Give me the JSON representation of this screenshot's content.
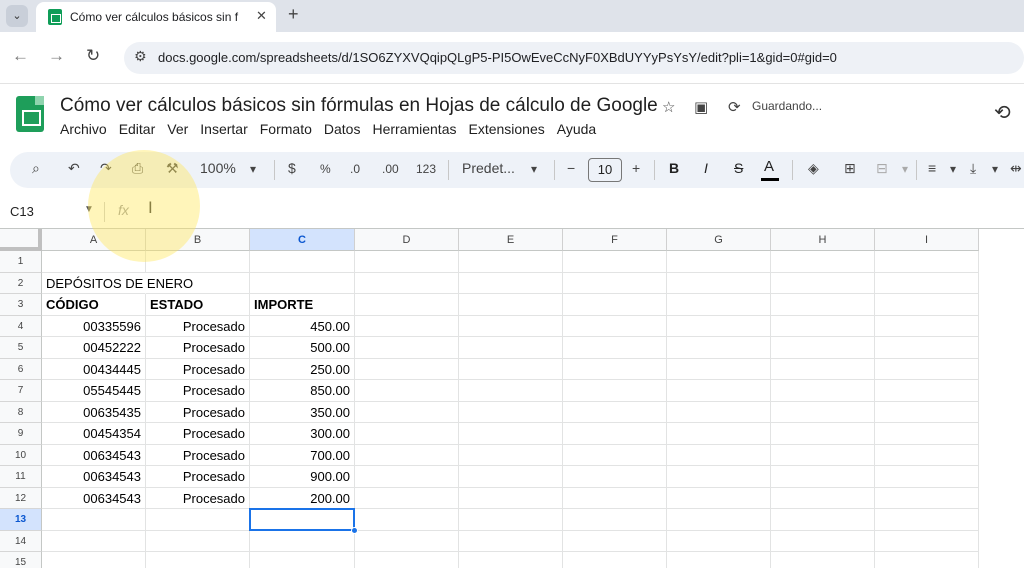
{
  "browser": {
    "tab_title": "Cómo ver cálculos básicos sin f",
    "url": "docs.google.com/spreadsheets/d/1SO6ZYXVQqipQLgP5-PI5OwEveCcNyF0XBdUYYyPsYsY/edit?pli=1&gid=0#gid=0"
  },
  "doc": {
    "title": "Cómo ver cálculos básicos sin fórmulas en Hojas de cálculo de Google",
    "status": "Guardando..."
  },
  "menu": [
    "Archivo",
    "Editar",
    "Ver",
    "Insertar",
    "Formato",
    "Datos",
    "Herramientas",
    "Extensiones",
    "Ayuda"
  ],
  "toolbar": {
    "zoom": "100%",
    "currency": "$",
    "percent": "%",
    "dec_decrease": ".0",
    "dec_increase": ".00",
    "number_format": "123",
    "font": "Predet...",
    "font_size": "10",
    "bold": "B",
    "italic": "I",
    "strike": "S",
    "text_color": "A"
  },
  "formula_bar": {
    "name_box": "C13",
    "fx": "fx",
    "value": ""
  },
  "grid": {
    "columns": [
      "A",
      "B",
      "C",
      "D",
      "E",
      "F",
      "G",
      "H",
      "I"
    ],
    "selected_column": "C",
    "rows": [
      "1",
      "2",
      "3",
      "4",
      "5",
      "6",
      "7",
      "8",
      "9",
      "10",
      "11",
      "12",
      "13",
      "14",
      "15"
    ],
    "selected_row": "13",
    "selected_cell": "C13",
    "title_cell": "DEPÓSITOS DE ENERO",
    "headers": [
      "CÓDIGO",
      "ESTADO",
      "IMPORTE"
    ],
    "data": [
      [
        "00335596",
        "Procesado",
        "450.00"
      ],
      [
        "00452222",
        "Procesado",
        "500.00"
      ],
      [
        "00434445",
        "Procesado",
        "250.00"
      ],
      [
        "05545445",
        "Procesado",
        "850.00"
      ],
      [
        "00635435",
        "Procesado",
        "350.00"
      ],
      [
        "00454354",
        "Procesado",
        "300.00"
      ],
      [
        "00634543",
        "Procesado",
        "700.00"
      ],
      [
        "00634543",
        "Procesado",
        "900.00"
      ],
      [
        "00634543",
        "Procesado",
        "200.00"
      ]
    ]
  },
  "colors": {
    "accent": "#1a73e8",
    "selected_header_bg": "#d3e3fd",
    "sheets_green": "#1e9e5a"
  }
}
